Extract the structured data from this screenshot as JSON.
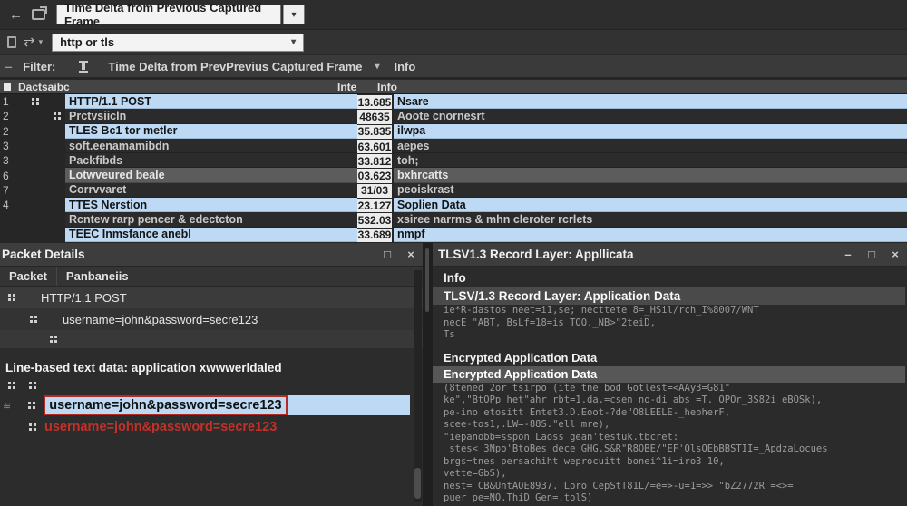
{
  "accent_colors": {
    "selection_blue": "#bdd9f3",
    "alert_red": "#c33128",
    "panel_gray": "#3d3d3d"
  },
  "toolbar": {
    "back_icon": "back-arrow",
    "column_dropdown_value": "Time Delta from Previous Captured Frame",
    "dropdown_caret": "▾",
    "filter_input_value": "http or tls"
  },
  "filter_row": {
    "dash": "‒",
    "label": "Filter:",
    "column_value": "Time Delta from PrevPrevius Captured Frame",
    "caret": "▾",
    "info_label": "Info"
  },
  "packet_list": {
    "header": {
      "left": "Dactsaibc",
      "time": "Inte",
      "info": "Info"
    },
    "rows": [
      {
        "no": "1",
        "desc": "HTTP/1.1 POST",
        "time": "13.685",
        "info": "Nsare"
      },
      {
        "no": "2",
        "desc": "Prctvsiicln",
        "time": "48635",
        "info": "Aoote cnornesrt"
      },
      {
        "no": "2",
        "desc": "TLES Bc1 tor metler",
        "time": "35.835",
        "info": "ilwpa"
      },
      {
        "no": "3",
        "desc": "soft.eenamamibdn",
        "time": "63.601",
        "info": "aepes"
      },
      {
        "no": "3",
        "desc": "Packfibds",
        "time": "33.812",
        "info": "toh;"
      },
      {
        "no": "6",
        "desc": "Lotwveured beale",
        "time": "03.623",
        "info": "bxhrcatts"
      },
      {
        "no": "7",
        "desc": "Corrvvaret",
        "time": "31/03",
        "info": "peoiskrast"
      },
      {
        "no": "4",
        "desc": "TTES Nerstion",
        "time": "23.127",
        "info": "Soplien Data"
      },
      {
        "no": "",
        "desc": "Rcntew rarp pencer & edectcton",
        "time": "532.03",
        "info": "xsiree narrms & mhn cleroter rcrlets"
      },
      {
        "no": "",
        "desc": "TEEC Inmsfance anebl",
        "time": "33.689",
        "info": "nmpf"
      }
    ]
  },
  "details_panel": {
    "title": "Packet Details",
    "maximize": "□",
    "close": "×",
    "tabs": {
      "tab1": "Packet",
      "tab2": "Panbaneiis"
    },
    "tree": {
      "row1": "HTTP/1.1 POST",
      "row2": "username=john&password=secre123"
    },
    "section_label": "Line-based text data: application xwwwerldaled",
    "highlighted_value": "username=john&password=secre123",
    "red_value": "username=john&password=secre123"
  },
  "tls_panel": {
    "title": "TLSV1.3 Record Layer: Appllicata",
    "minimize": "–",
    "maximize": "□",
    "close": "×",
    "info_label": "Info",
    "record_header": "TLSV/1.3 Record Layer: Application Data",
    "hex1": [
      "ie*R-dastos neet=i1,se; necttete 8=_HSil/rch_I%8007/WNT",
      "necE \"ABT, BsLf=18=is TOQ._NB>\"2teiD,",
      "Ts"
    ],
    "encrypted_label": "Encrypted Application Data",
    "encrypted_selected": "Encrypted Application Data",
    "hex2": [
      "(8tened 2or tsirpo (ite tne bod Gotlest=<AAy3=G81\"",
      "ke\",\"BtOPp het\"ahr rbt=1.da.=csen no-di abs =T. OPOr_3S82i eBOSk),",
      "pe-ino etositt Entet3.D.Eoot-?de\"O8LEELE-_hepherF,",
      "scee-tos1,.LW=-88S.\"ell mre),",
      "\"iepanobb=sspon Laoss gean'testuk.tbcret:",
      " stes< 3Npo'BtoBes dece GHG.S&R\"R8OBE/\"EF'OlsOEbBBSTII=_ApdzaLocues",
      "brgs=tnes persachiht weprocuitt bonei^1i=iro3 10,",
      "vette=GbS),",
      "nest= CB&UntAOE8937. Loro CepStT81L/=e=>-u=1=>> \"bZ2772R =<>=",
      "puer pe=NO.ThiD Gen=.tolS)"
    ]
  }
}
